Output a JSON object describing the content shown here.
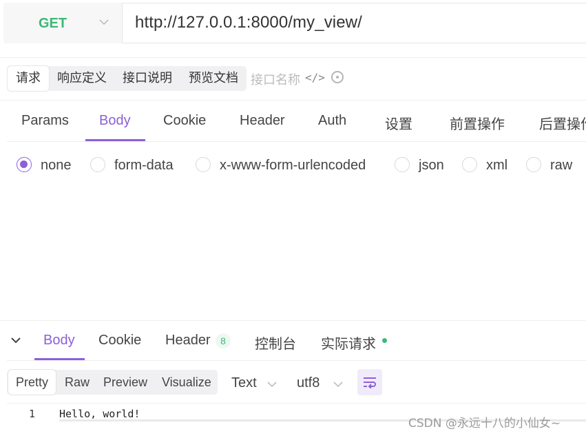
{
  "request_bar": {
    "method": "GET",
    "url": "http://127.0.0.1:8000/my_view/"
  },
  "doc_tabs": {
    "items": [
      "请求",
      "响应定义",
      "接口说明",
      "预览文档"
    ],
    "active": "请求",
    "name_placeholder": "接口名称",
    "code_icon_glyph": "</>"
  },
  "request_tabs": {
    "items": [
      "Params",
      "Body",
      "Cookie",
      "Header",
      "Auth",
      "设置",
      "前置操作",
      "后置操作"
    ],
    "active": "Body"
  },
  "body_types": {
    "options": [
      "none",
      "form-data",
      "x-www-form-urlencoded",
      "json",
      "xml",
      "raw"
    ],
    "selected": "none"
  },
  "response_tabs": {
    "items": [
      "Body",
      "Cookie",
      "Header",
      "控制台",
      "实际请求"
    ],
    "active": "Body",
    "header_count": "8"
  },
  "response_view": {
    "modes": [
      "Pretty",
      "Raw",
      "Preview",
      "Visualize"
    ],
    "active_mode": "Pretty",
    "format": "Text",
    "encoding": "utf8"
  },
  "response_body": {
    "line_number": "1",
    "content": "Hello, world!"
  },
  "watermark": "CSDN @永远十八的小仙女~",
  "colors": {
    "accent": "#8c5fd8",
    "method_get": "#3cb878",
    "status_dot": "#3cb878"
  }
}
